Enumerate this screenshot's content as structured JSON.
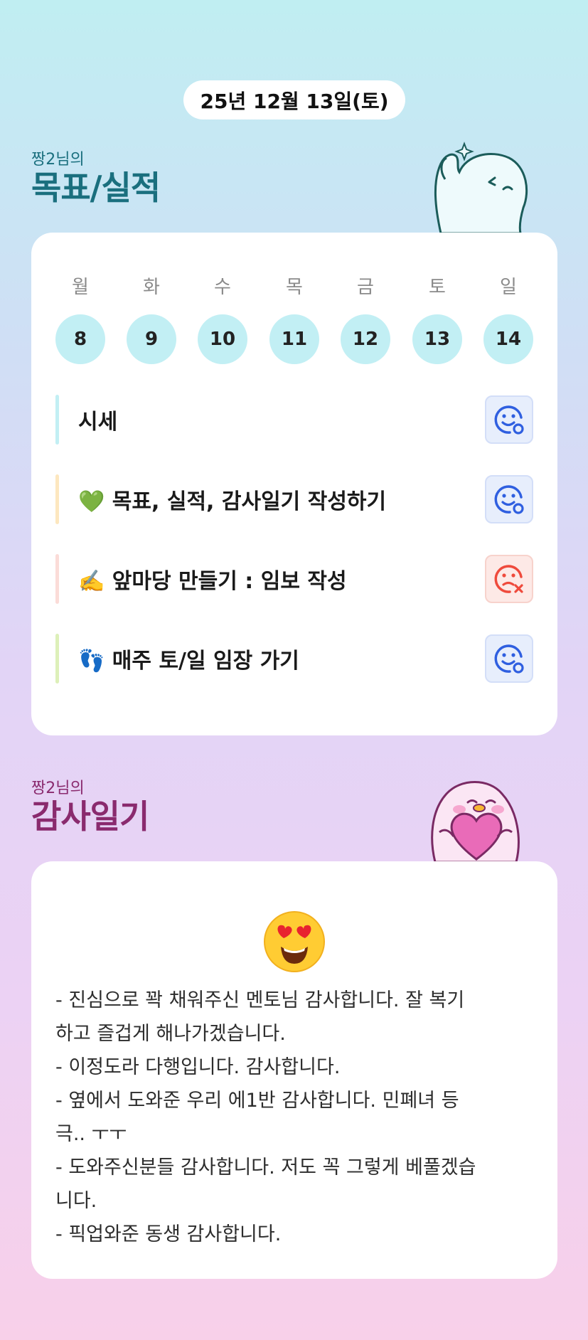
{
  "date": "25년 12월 13일(토)",
  "goals_section": {
    "owner": "짱2님의",
    "title": "목표/실적"
  },
  "week": {
    "days": [
      "월",
      "화",
      "수",
      "목",
      "금",
      "토",
      "일"
    ],
    "dates": [
      "8",
      "9",
      "10",
      "11",
      "12",
      "13",
      "14"
    ]
  },
  "goals": [
    {
      "label": "시세",
      "status": "achieved",
      "bar_color": "#c2eff4"
    },
    {
      "label": "💚 목표, 실적, 감사일기 작성하기",
      "status": "achieved",
      "bar_color": "#fde7bf"
    },
    {
      "label": "✍️ 앞마당 만들기 : 임보 작성",
      "status": "not-achieved",
      "bar_color": "#fbdcd8"
    },
    {
      "label": "👣 매주 토/일 임장 가기",
      "status": "achieved",
      "bar_color": "#ddf0b9"
    }
  ],
  "gratitude_section": {
    "owner": "짱2님의",
    "title": "감사일기"
  },
  "gratitude": {
    "emoji_icon": "heart-eyes-emoji",
    "lines": [
      "- 진심으로 꽉 채워주신 멘토님 감사합니다. 잘 복기",
      "하고 즐겁게 해나가겠습니다.",
      "- 이정도라 다행입니다. 감사합니다.",
      "- 옆에서 도와준 우리 에1반 감사합니다. 민폐녀 등",
      "극.. ㅜㅜ",
      "- 도와주신분들 감사합니다. 저도 꼭 그렇게 베풀겠습",
      "니다.",
      "- 픽업와준 동생 감사합니다."
    ]
  },
  "colors": {
    "accent_teal": "#1a6f7e",
    "accent_plum": "#8a2a6e",
    "day_circle": "#c2eff4",
    "status_good": "#2f5fe0",
    "status_bad": "#ef4a3c"
  }
}
